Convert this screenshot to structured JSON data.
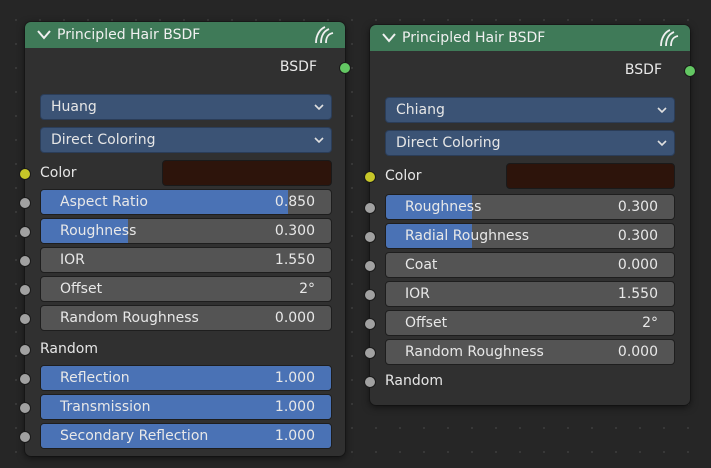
{
  "left_node": {
    "title": "Principled Hair BSDF",
    "output": "BSDF",
    "model": "Huang",
    "parametrization": "Direct Coloring",
    "color_label": "Color",
    "color_value": "#2d140b",
    "fields": [
      {
        "label": "Aspect Ratio",
        "value": "0.850",
        "fill_fraction": 0.85
      },
      {
        "label": "Roughness",
        "value": "0.300",
        "fill_fraction": 0.3
      },
      {
        "label": "IOR",
        "value": "1.550",
        "fill_fraction": 0
      },
      {
        "label": "Offset",
        "value": "2°",
        "fill_fraction": 0
      },
      {
        "label": "Random Roughness",
        "value": "0.000",
        "fill_fraction": 0
      }
    ],
    "random_label": "Random",
    "fields2": [
      {
        "label": "Reflection",
        "value": "1.000",
        "fill_fraction": 1
      },
      {
        "label": "Transmission",
        "value": "1.000",
        "fill_fraction": 1
      },
      {
        "label": "Secondary Reflection",
        "value": "1.000",
        "fill_fraction": 1
      }
    ]
  },
  "right_node": {
    "title": "Principled Hair BSDF",
    "output": "BSDF",
    "model": "Chiang",
    "parametrization": "Direct Coloring",
    "color_label": "Color",
    "color_value": "#2d140b",
    "fields": [
      {
        "label": "Roughness",
        "value": "0.300",
        "fill_fraction": 0.3
      },
      {
        "label": "Radial Roughness",
        "value": "0.300",
        "fill_fraction": 0.3
      },
      {
        "label": "Coat",
        "value": "0.000",
        "fill_fraction": 0
      },
      {
        "label": "IOR",
        "value": "1.550",
        "fill_fraction": 0
      },
      {
        "label": "Offset",
        "value": "2°",
        "fill_fraction": 0
      },
      {
        "label": "Random Roughness",
        "value": "0.000",
        "fill_fraction": 0
      }
    ],
    "random_label": "Random"
  },
  "colors": {
    "header": "#3f7a58",
    "dropdown": "#3b5375",
    "slider_fill": "#4a72b5",
    "field": "#545454",
    "socket_shader": "#63c763",
    "socket_color": "#c7c729",
    "socket_float": "#a1a1a1"
  }
}
